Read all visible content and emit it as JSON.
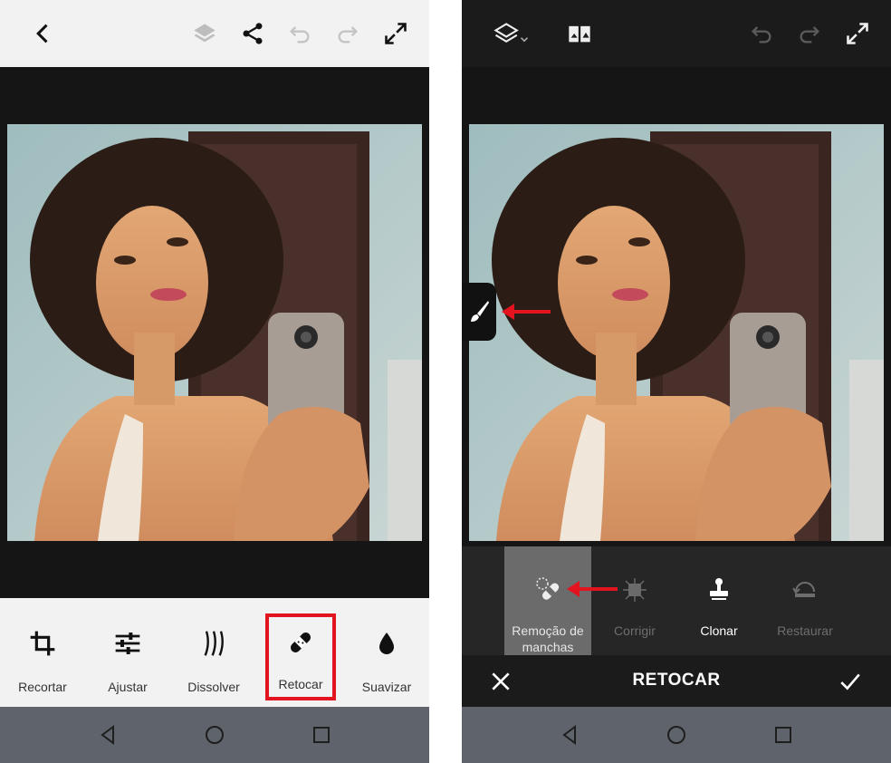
{
  "left_screen": {
    "tools": [
      {
        "label": "Recortar",
        "icon": "crop-icon"
      },
      {
        "label": "Ajustar",
        "icon": "sliders-icon"
      },
      {
        "label": "Dissolver",
        "icon": "dissolve-icon"
      },
      {
        "label": "Retocar",
        "icon": "bandage-icon",
        "selected": true
      },
      {
        "label": "Suavizar",
        "icon": "drop-icon"
      }
    ]
  },
  "right_screen": {
    "subtools": [
      {
        "label": "Remoção de manchas",
        "icon": "spot-healing-icon",
        "state": "active"
      },
      {
        "label": "Corrigir",
        "icon": "patch-icon",
        "state": "disabled"
      },
      {
        "label": "Clonar",
        "icon": "clone-stamp-icon",
        "state": "enabled"
      },
      {
        "label": "Restaurar",
        "icon": "restore-icon",
        "state": "disabled"
      }
    ],
    "action_title": "RETOCAR"
  },
  "colors": {
    "highlight_red": "#e3141f",
    "toolbar_light": "#f2f2f2",
    "toolbar_dark": "#1b1b1b",
    "navbar": "#5f646c"
  }
}
